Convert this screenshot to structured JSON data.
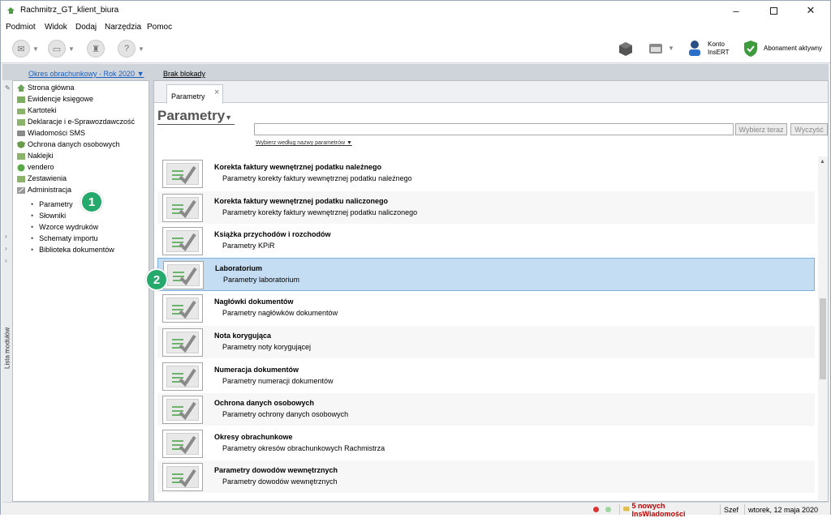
{
  "window": {
    "title": "Rachmitrz_GT_klient_biura"
  },
  "menu": [
    "Podmiot",
    "Widok",
    "Dodaj",
    "Narzędzia",
    "Pomoc"
  ],
  "toolbar_right": {
    "konto_line1": "Konto",
    "konto_line2": "InsERT",
    "abonament": "Abonament aktywny"
  },
  "infobar": {
    "period": "Okres obrachunkowy - Rok 2020",
    "lock": "Brak blokady"
  },
  "vtab_label": "Lista modułów",
  "sidebar": {
    "items": [
      "Strona główna",
      "Ewidencje księgowe",
      "Kartoteki",
      "Deklaracje i e-Sprawozdawczość",
      "Wiadomości SMS",
      "Ochrona danych osobowych",
      "Naklejki",
      "vendero",
      "Zestawienia",
      "Administracja"
    ],
    "subitems": [
      "Parametry",
      "Słowniki",
      "Wzorce wydruków",
      "Schematy importu",
      "Biblioteka dokumentów"
    ]
  },
  "badges": {
    "b1": "1",
    "b2": "2"
  },
  "tab": {
    "label": "Parametry",
    "close": "×"
  },
  "page_title": "Parametry",
  "search": {
    "btn_select": "Wybierz teraz",
    "btn_clear": "Wyczyść",
    "sort_label": "Wybierz według nazwy parametrów"
  },
  "rows": [
    {
      "title": "Korekta faktury wewnętrznej podatku należnego",
      "desc": "Parametry korekty faktury wewnętrznej podatku należnego"
    },
    {
      "title": "Korekta faktury wewnętrznej podatku naliczonego",
      "desc": "Parametry korekty faktury wewnętrznej podatku naliczonego"
    },
    {
      "title": "Książka przychodów i rozchodów",
      "desc": "Parametry KPiR"
    },
    {
      "title": "Laboratorium",
      "desc": "Parametry laboratorium"
    },
    {
      "title": "Nagłówki dokumentów",
      "desc": "Parametry nagłówków dokumentów"
    },
    {
      "title": "Nota korygująca",
      "desc": "Parametry noty korygującej"
    },
    {
      "title": "Numeracja dokumentów",
      "desc": "Parametry numeracji dokumentów"
    },
    {
      "title": "Ochrona danych osobowych",
      "desc": "Parametry ochrony danych osobowych"
    },
    {
      "title": "Okresy obrachunkowe",
      "desc": "Parametry okresów obrachunkowych Rachmistrza"
    },
    {
      "title": "Parametry dowodów wewnętrznych",
      "desc": "Parametry dowodów wewnętrznych"
    }
  ],
  "status": {
    "news": "5 nowych InsWiadomości",
    "user": "Szef",
    "date": "wtorek, 12 maja 2020"
  },
  "colors": {
    "selected_row": "#c5ddf2",
    "badge": "#26a96c",
    "link": "#1a5fc0",
    "news": "#c00000"
  }
}
